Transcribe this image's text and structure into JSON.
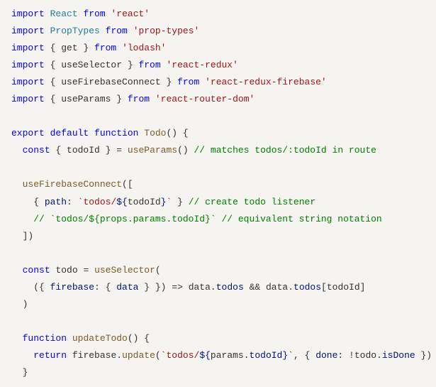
{
  "code": {
    "lines": [
      [
        {
          "cls": "keyword",
          "t": "import"
        },
        {
          "cls": "punct",
          "t": " "
        },
        {
          "cls": "type",
          "t": "React"
        },
        {
          "cls": "punct",
          "t": " "
        },
        {
          "cls": "keyword",
          "t": "from"
        },
        {
          "cls": "punct",
          "t": " "
        },
        {
          "cls": "string",
          "t": "'react'"
        }
      ],
      [
        {
          "cls": "keyword",
          "t": "import"
        },
        {
          "cls": "punct",
          "t": " "
        },
        {
          "cls": "type",
          "t": "PropTypes"
        },
        {
          "cls": "punct",
          "t": " "
        },
        {
          "cls": "keyword",
          "t": "from"
        },
        {
          "cls": "punct",
          "t": " "
        },
        {
          "cls": "string",
          "t": "'prop-types'"
        }
      ],
      [
        {
          "cls": "keyword",
          "t": "import"
        },
        {
          "cls": "punct",
          "t": " { "
        },
        {
          "cls": "identifier",
          "t": "get"
        },
        {
          "cls": "punct",
          "t": " } "
        },
        {
          "cls": "keyword",
          "t": "from"
        },
        {
          "cls": "punct",
          "t": " "
        },
        {
          "cls": "string",
          "t": "'lodash'"
        }
      ],
      [
        {
          "cls": "keyword",
          "t": "import"
        },
        {
          "cls": "punct",
          "t": " { "
        },
        {
          "cls": "identifier",
          "t": "useSelector"
        },
        {
          "cls": "punct",
          "t": " } "
        },
        {
          "cls": "keyword",
          "t": "from"
        },
        {
          "cls": "punct",
          "t": " "
        },
        {
          "cls": "string",
          "t": "'react-redux'"
        }
      ],
      [
        {
          "cls": "keyword",
          "t": "import"
        },
        {
          "cls": "punct",
          "t": " { "
        },
        {
          "cls": "identifier",
          "t": "useFirebaseConnect"
        },
        {
          "cls": "punct",
          "t": " } "
        },
        {
          "cls": "keyword",
          "t": "from"
        },
        {
          "cls": "punct",
          "t": " "
        },
        {
          "cls": "string",
          "t": "'react-redux-firebase'"
        }
      ],
      [
        {
          "cls": "keyword",
          "t": "import"
        },
        {
          "cls": "punct",
          "t": " { "
        },
        {
          "cls": "identifier",
          "t": "useParams"
        },
        {
          "cls": "punct",
          "t": " } "
        },
        {
          "cls": "keyword",
          "t": "from"
        },
        {
          "cls": "punct",
          "t": " "
        },
        {
          "cls": "string",
          "t": "'react-router-dom'"
        }
      ],
      [],
      [
        {
          "cls": "keyword",
          "t": "export"
        },
        {
          "cls": "punct",
          "t": " "
        },
        {
          "cls": "keyword",
          "t": "default"
        },
        {
          "cls": "punct",
          "t": " "
        },
        {
          "cls": "keyword",
          "t": "function"
        },
        {
          "cls": "punct",
          "t": " "
        },
        {
          "cls": "func-name",
          "t": "Todo"
        },
        {
          "cls": "punct",
          "t": "() {"
        }
      ],
      [
        {
          "cls": "punct",
          "t": "  "
        },
        {
          "cls": "keyword",
          "t": "const"
        },
        {
          "cls": "punct",
          "t": " { "
        },
        {
          "cls": "identifier",
          "t": "todoId"
        },
        {
          "cls": "punct",
          "t": " } = "
        },
        {
          "cls": "call",
          "t": "useParams"
        },
        {
          "cls": "punct",
          "t": "() "
        },
        {
          "cls": "comment",
          "t": "// matches todos/:todoId in route"
        }
      ],
      [],
      [
        {
          "cls": "punct",
          "t": "  "
        },
        {
          "cls": "call",
          "t": "useFirebaseConnect"
        },
        {
          "cls": "punct",
          "t": "(["
        }
      ],
      [
        {
          "cls": "punct",
          "t": "    { "
        },
        {
          "cls": "property",
          "t": "path"
        },
        {
          "cls": "punct",
          "t": ": "
        },
        {
          "cls": "string",
          "t": "`todos/"
        },
        {
          "cls": "template-var",
          "t": "${"
        },
        {
          "cls": "identifier",
          "t": "todoId"
        },
        {
          "cls": "template-var",
          "t": "}"
        },
        {
          "cls": "string",
          "t": "`"
        },
        {
          "cls": "punct",
          "t": " } "
        },
        {
          "cls": "comment",
          "t": "// create todo listener"
        }
      ],
      [
        {
          "cls": "punct",
          "t": "    "
        },
        {
          "cls": "comment",
          "t": "// `todos/${props.params.todoId}` // equivalent string notation"
        }
      ],
      [
        {
          "cls": "punct",
          "t": "  ])"
        }
      ],
      [],
      [
        {
          "cls": "punct",
          "t": "  "
        },
        {
          "cls": "keyword",
          "t": "const"
        },
        {
          "cls": "punct",
          "t": " "
        },
        {
          "cls": "identifier",
          "t": "todo"
        },
        {
          "cls": "punct",
          "t": " = "
        },
        {
          "cls": "call",
          "t": "useSelector"
        },
        {
          "cls": "punct",
          "t": "("
        }
      ],
      [
        {
          "cls": "punct",
          "t": "    ({ "
        },
        {
          "cls": "property",
          "t": "firebase"
        },
        {
          "cls": "punct",
          "t": ": { "
        },
        {
          "cls": "property",
          "t": "data"
        },
        {
          "cls": "punct",
          "t": " } }) "
        },
        {
          "cls": "operator",
          "t": "=>"
        },
        {
          "cls": "punct",
          "t": " "
        },
        {
          "cls": "identifier",
          "t": "data"
        },
        {
          "cls": "punct",
          "t": "."
        },
        {
          "cls": "property",
          "t": "todos"
        },
        {
          "cls": "punct",
          "t": " "
        },
        {
          "cls": "operator",
          "t": "&&"
        },
        {
          "cls": "punct",
          "t": " "
        },
        {
          "cls": "identifier",
          "t": "data"
        },
        {
          "cls": "punct",
          "t": "."
        },
        {
          "cls": "property",
          "t": "todos"
        },
        {
          "cls": "punct",
          "t": "["
        },
        {
          "cls": "identifier",
          "t": "todoId"
        },
        {
          "cls": "punct",
          "t": "]"
        }
      ],
      [
        {
          "cls": "punct",
          "t": "  )"
        }
      ],
      [],
      [
        {
          "cls": "punct",
          "t": "  "
        },
        {
          "cls": "keyword",
          "t": "function"
        },
        {
          "cls": "punct",
          "t": " "
        },
        {
          "cls": "func-name",
          "t": "updateTodo"
        },
        {
          "cls": "punct",
          "t": "() {"
        }
      ],
      [
        {
          "cls": "punct",
          "t": "    "
        },
        {
          "cls": "keyword",
          "t": "return"
        },
        {
          "cls": "punct",
          "t": " "
        },
        {
          "cls": "identifier",
          "t": "firebase"
        },
        {
          "cls": "punct",
          "t": "."
        },
        {
          "cls": "call",
          "t": "update"
        },
        {
          "cls": "punct",
          "t": "("
        },
        {
          "cls": "string",
          "t": "`todos/"
        },
        {
          "cls": "template-var",
          "t": "${"
        },
        {
          "cls": "identifier",
          "t": "params"
        },
        {
          "cls": "punct",
          "t": "."
        },
        {
          "cls": "property",
          "t": "todoId"
        },
        {
          "cls": "template-var",
          "t": "}"
        },
        {
          "cls": "string",
          "t": "`"
        },
        {
          "cls": "punct",
          "t": ", { "
        },
        {
          "cls": "property",
          "t": "done"
        },
        {
          "cls": "punct",
          "t": ": "
        },
        {
          "cls": "operator",
          "t": "!"
        },
        {
          "cls": "identifier",
          "t": "todo"
        },
        {
          "cls": "punct",
          "t": "."
        },
        {
          "cls": "property",
          "t": "isDone"
        },
        {
          "cls": "punct",
          "t": " })"
        }
      ],
      [
        {
          "cls": "punct",
          "t": "  }"
        }
      ]
    ]
  }
}
